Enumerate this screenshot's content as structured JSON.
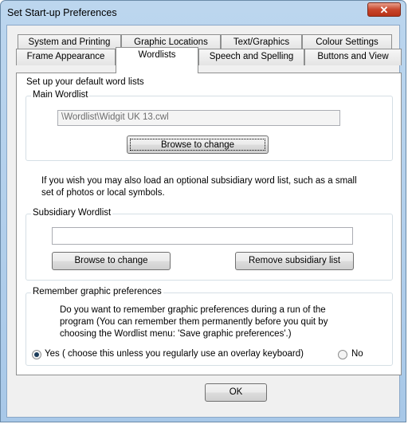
{
  "window": {
    "title": "Set Start-up Preferences",
    "close_glyph": "✕"
  },
  "tabs": {
    "row1": [
      "System and Printing",
      "Graphic Locations",
      "Text/Graphics",
      "Colour Settings"
    ],
    "row2": [
      "Frame Appearance",
      "Wordlists",
      "Speech and Spelling",
      "Buttons and View"
    ],
    "active": "Wordlists"
  },
  "panel": {
    "intro": "Set up your default word lists",
    "main_wordlist": {
      "legend": "Main Wordlist",
      "path_value": "\\Wordlist\\Widgit UK 13.cwl",
      "browse_label": "Browse to change"
    },
    "optional_text_line1": "If you wish you may also load an optional subsidiary word list, such as a small",
    "optional_text_line2": "set of photos or local symbols.",
    "subsidiary": {
      "legend": "Subsidiary Wordlist",
      "path_value": "",
      "browse_label": "Browse to change",
      "remove_label": "Remove subsidiary list"
    },
    "remember": {
      "legend": "Remember graphic preferences",
      "line1": "Do you want to remember graphic preferences during a run of the",
      "line2": "program (You can remember them permanently before you quit by",
      "line3": "choosing the Wordlist menu:  'Save graphic preferences'.)",
      "yes_label": "Yes ( choose this unless you regularly use an overlay keyboard)",
      "no_label": "No",
      "selected": "Yes"
    }
  },
  "footer": {
    "ok_label": "OK"
  }
}
